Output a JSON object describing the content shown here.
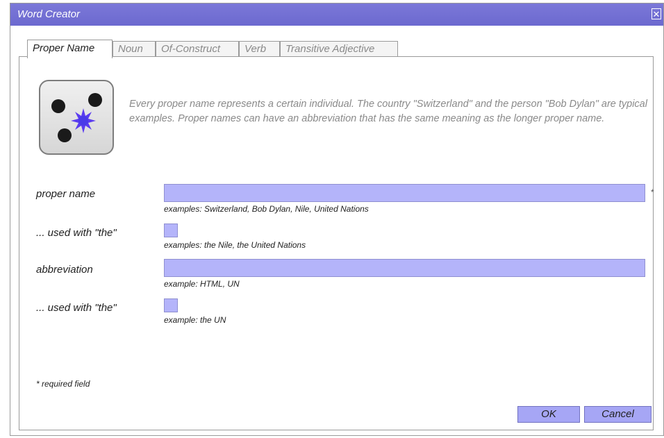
{
  "window": {
    "title": "Word Creator",
    "close_label": "✕"
  },
  "tabs": [
    {
      "label": "Proper Name",
      "active": true
    },
    {
      "label": "Noun",
      "active": false
    },
    {
      "label": "Of-Construct",
      "active": false
    },
    {
      "label": "Verb",
      "active": false
    },
    {
      "label": "Transitive Adjective",
      "active": false
    }
  ],
  "description": "Every proper name represents a certain individual. The country \"Switzerland\" and the person \"Bob Dylan\" are typical examples. Proper names can have an abbreviation that has the same meaning as the longer proper name.",
  "icon": {
    "name": "proper-name-dice-icon"
  },
  "form": {
    "proper_name": {
      "label": "proper name",
      "value": "",
      "hint": "examples: Switzerland, Bob Dylan, Nile, United Nations",
      "required_marker": "*"
    },
    "proper_name_the": {
      "label": "... used with \"the\"",
      "checked": false,
      "hint": "examples: the Nile, the United Nations"
    },
    "abbreviation": {
      "label": "abbreviation",
      "value": "",
      "hint": "example: HTML, UN"
    },
    "abbreviation_the": {
      "label": "... used with \"the\"",
      "checked": false,
      "hint": "example: the UN"
    },
    "required_note": "* required field"
  },
  "buttons": {
    "ok": "OK",
    "cancel": "Cancel"
  },
  "colors": {
    "titlebar": "#6c69cf",
    "input_fill": "#b4b4fa",
    "button_fill": "#a6a6f5",
    "icon_star": "#5b3cf0"
  }
}
